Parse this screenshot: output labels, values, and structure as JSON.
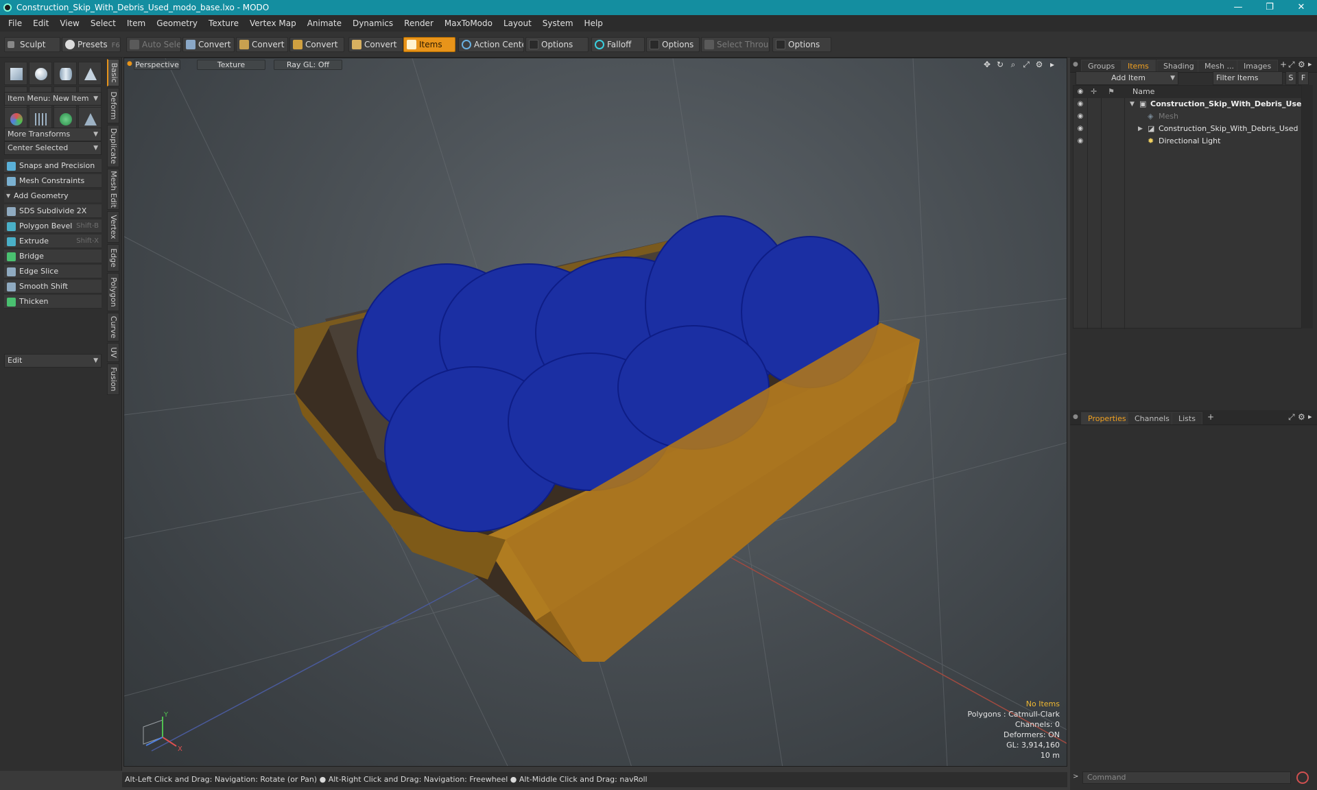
{
  "window": {
    "title": "Construction_Skip_With_Debris_Used_modo_base.lxo - MODO",
    "controls": [
      "—",
      "❐",
      "✕"
    ]
  },
  "menu": [
    "File",
    "Edit",
    "View",
    "Select",
    "Item",
    "Geometry",
    "Texture",
    "Vertex Map",
    "Animate",
    "Dynamics",
    "Render",
    "MaxToModo",
    "Layout",
    "System",
    "Help"
  ],
  "toolbar": {
    "sculpt": "Sculpt",
    "presets": "Presets",
    "presets_key": "F6",
    "auto_select": "Auto Select",
    "convert1": "Convert",
    "convert2": "Convert",
    "convert3": "Convert",
    "convert4": "Convert",
    "items": "Items",
    "action_center": "Action Center",
    "options1": "Options",
    "falloff": "Falloff",
    "options2": "Options",
    "select_through": "Select Through",
    "options3": "Options"
  },
  "left": {
    "item_menu": "Item Menu: New Item",
    "more_transforms": "More Transforms",
    "center_selected": "Center Selected",
    "snaps": "Snaps and Precision",
    "mesh_constraints": "Mesh Constraints",
    "add_geometry": "Add Geometry",
    "tools": [
      {
        "label": "SDS Subdivide 2X",
        "key": ""
      },
      {
        "label": "Polygon Bevel",
        "key": "Shift-B"
      },
      {
        "label": "Extrude",
        "key": "Shift-X"
      },
      {
        "label": "Bridge",
        "key": ""
      },
      {
        "label": "Edge Slice",
        "key": ""
      },
      {
        "label": "Smooth Shift",
        "key": ""
      },
      {
        "label": "Thicken",
        "key": ""
      }
    ],
    "edit": "Edit",
    "vtabs": [
      "Basic",
      "Deform",
      "Duplicate",
      "Mesh Edit",
      "Vertex",
      "Edge",
      "Polygon",
      "Curve",
      "UV",
      "Fusion"
    ]
  },
  "viewport": {
    "perspective": "Perspective",
    "texture": "Texture",
    "raygl": "Ray GL: Off",
    "stats": {
      "no_items": "No Items",
      "polygons": "Polygons : Catmull-Clark",
      "channels": "Channels: 0",
      "deformers": "Deformers: ON",
      "gl": "GL: 3,914,160",
      "scale": "10 m"
    },
    "axis_x": "X",
    "axis_y": "Y"
  },
  "status": "Alt-Left Click and Drag: Navigation: Rotate (or Pan) ● Alt-Right Click and Drag: Navigation: Freewheel ● Alt-Middle Click and Drag: navRoll",
  "right": {
    "tabs_top": [
      "Groups",
      "Items",
      "Shading",
      "Mesh ...",
      "Images"
    ],
    "add_item": "Add Item",
    "filter_items": "Filter Items",
    "s": "S",
    "f": "F",
    "name_col": "Name",
    "tree": [
      {
        "label": "Construction_Skip_With_Debris_Use...",
        "indent": 0
      },
      {
        "label": "Mesh",
        "indent": 1
      },
      {
        "label": "Construction_Skip_With_Debris_Used",
        "indent": 1
      },
      {
        "label": "Directional Light",
        "indent": 1
      }
    ],
    "tabs_bottom": [
      "Properties",
      "Channels",
      "Lists"
    ],
    "command_placeholder": "Command"
  }
}
